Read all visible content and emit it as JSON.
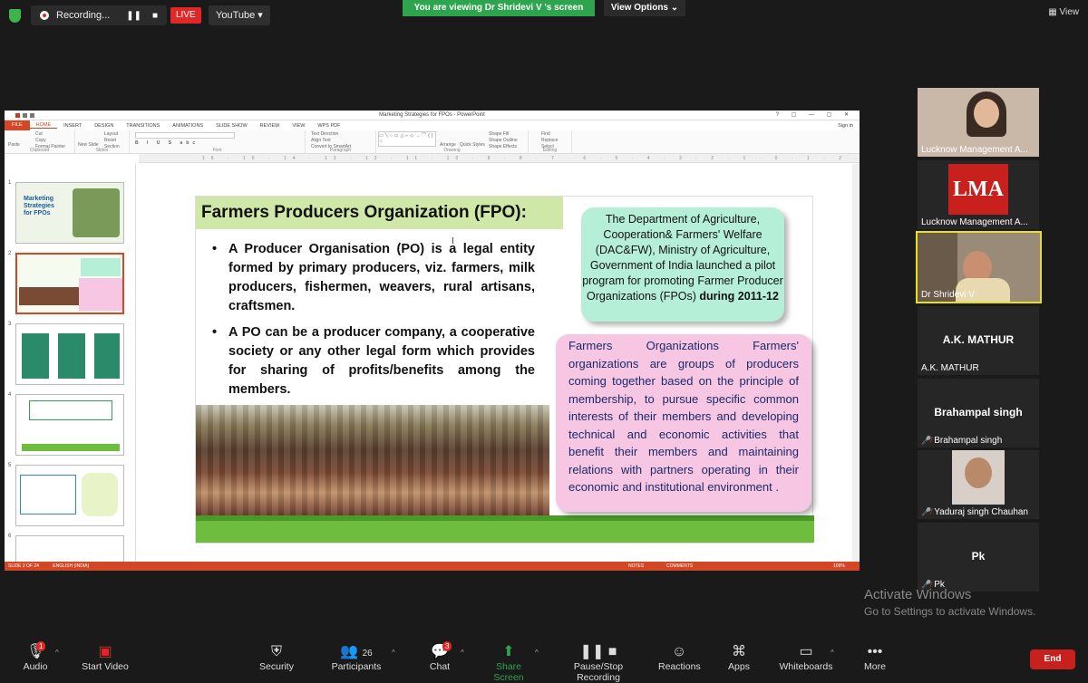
{
  "topbar": {
    "recording_label": "Recording...",
    "live_label": "LIVE",
    "stream_target": "YouTube",
    "viewing_banner": "You are viewing Dr  Shridevi V 's screen",
    "view_options": "View Options",
    "view_button": "View"
  },
  "ppt": {
    "window_title": "Marketing Strategies for FPOs - PowerPoint",
    "sign_in": "Sign in",
    "tabs": [
      "FILE",
      "HOME",
      "INSERT",
      "DESIGN",
      "TRANSITIONS",
      "ANIMATIONS",
      "SLIDE SHOW",
      "REVIEW",
      "VIEW",
      "WPS PDF"
    ],
    "ribbon_groups": [
      "Clipboard",
      "Slides",
      "Font",
      "Paragraph",
      "Drawing",
      "Editing"
    ],
    "ribbon_items": {
      "paste": "Paste",
      "cut": "Cut",
      "copy": "Copy",
      "format_painter": "Format Painter",
      "new_slide": "New Slide",
      "layout": "Layout",
      "reset": "Reset",
      "section": "Section",
      "text_direction": "Text Direction",
      "align_text": "Align Text",
      "convert_smartart": "Convert to SmartArt",
      "arrange": "Arrange",
      "quick_styles": "Quick Styles",
      "shape_fill": "Shape Fill",
      "shape_outline": "Shape Outline",
      "shape_effects": "Shape Effects",
      "find": "Find",
      "replace": "Replace",
      "select": "Select"
    },
    "ruler_text": "16 · 15 · 14 · 13 · 12 · 11 · 10 · 9 · 8 · 7 · 6 · 5 · 4 · 3 · 2 · 1 · 0 · 1 · 2 · 3 · 4 · 5 · 6 · 7 · 8 · 9 · 10 · 11 · 12 · 13 · 14 · 15 · 16",
    "thumb_numbers": [
      "1",
      "2",
      "3",
      "4",
      "5",
      "6"
    ],
    "thumb1_title": "Marketing Strategies for FPOs",
    "status": {
      "slide": "SLIDE 2 OF 24",
      "language": "ENGLISH (INDIA)",
      "notes": "NOTES",
      "comments": "COMMENTS",
      "zoom": "109%"
    }
  },
  "slide": {
    "title": "Farmers Producers Organization (FPO):",
    "bullet1": "A Producer Organisation (PO) is a legal entity formed by primary producers, viz. farmers, milk producers, fishermen, weavers, rural artisans, craftsmen.",
    "bullet2": "A PO can be a producer company, a cooperative society or any other legal form which provides for sharing of profits/benefits among the members.",
    "box1_text": "The Department of Agriculture, Cooperation& Farmers' Welfare (DAC&FW), Ministry of Agriculture, Government of India launched a pilot program for promoting Farmer Producer Organizations (FPOs)",
    "box1_bold": "during 2011-12",
    "box2_text": "Farmers Organizations Farmers' organizations are groups of producers coming together based on the principle of membership, to pursue specific common interests of their members and developing technical and economic activities that benefit their members and maintaining relations with partners operating in their economic and institutional environment ."
  },
  "participants": [
    {
      "name": "Lucknow Management A..."
    },
    {
      "name": "Lucknow Management A...",
      "logo": "LMA"
    },
    {
      "name": "Dr  Shridevi V"
    },
    {
      "name": "A.K. MATHUR",
      "big": "A.K. MATHUR"
    },
    {
      "name": "Brahampal singh",
      "big": "Brahampal singh",
      "muted": true
    },
    {
      "name": "Yaduraj singh Chauhan",
      "muted": true
    },
    {
      "name": "Pk",
      "big": "Pk",
      "muted": true
    }
  ],
  "watermark": {
    "line1": "Activate Windows",
    "line2": "Go to Settings to activate Windows."
  },
  "toolbar": {
    "audio": "Audio",
    "audio_badge": "1",
    "start_video": "Start Video",
    "security": "Security",
    "participants": "Participants",
    "participants_count": "26",
    "chat": "Chat",
    "chat_badge": "3",
    "share_screen": "Share Screen",
    "pause_recording": "Pause/Stop Recording",
    "reactions": "Reactions",
    "apps": "Apps",
    "whiteboards": "Whiteboards",
    "more": "More",
    "end": "End"
  },
  "colors": {
    "zoom_green": "#2ea44f",
    "live_red": "#e02828",
    "ppt_orange": "#d24726",
    "slide_title_bg": "#cfe8a8",
    "box1_bg": "#b6efd8",
    "box2_bg": "#f7c6e2",
    "active_speaker": "#e8e01a"
  }
}
